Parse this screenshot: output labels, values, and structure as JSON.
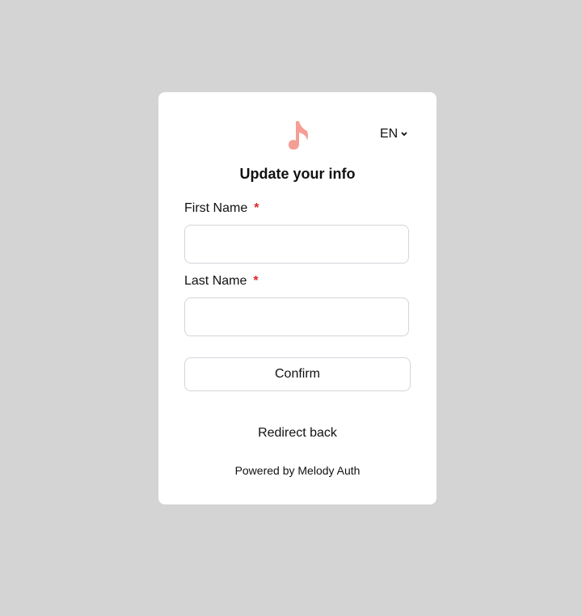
{
  "header": {
    "language": "EN",
    "title": "Update your info"
  },
  "form": {
    "first_name_label": "First Name",
    "last_name_label": "Last Name",
    "required_mark": "*",
    "first_name_value": "",
    "last_name_value": "",
    "confirm_label": "Confirm"
  },
  "footer": {
    "redirect_label": "Redirect back",
    "powered_by": "Powered by Melody Auth"
  },
  "colors": {
    "logo": "#f59e95",
    "required": "#dc2626"
  }
}
